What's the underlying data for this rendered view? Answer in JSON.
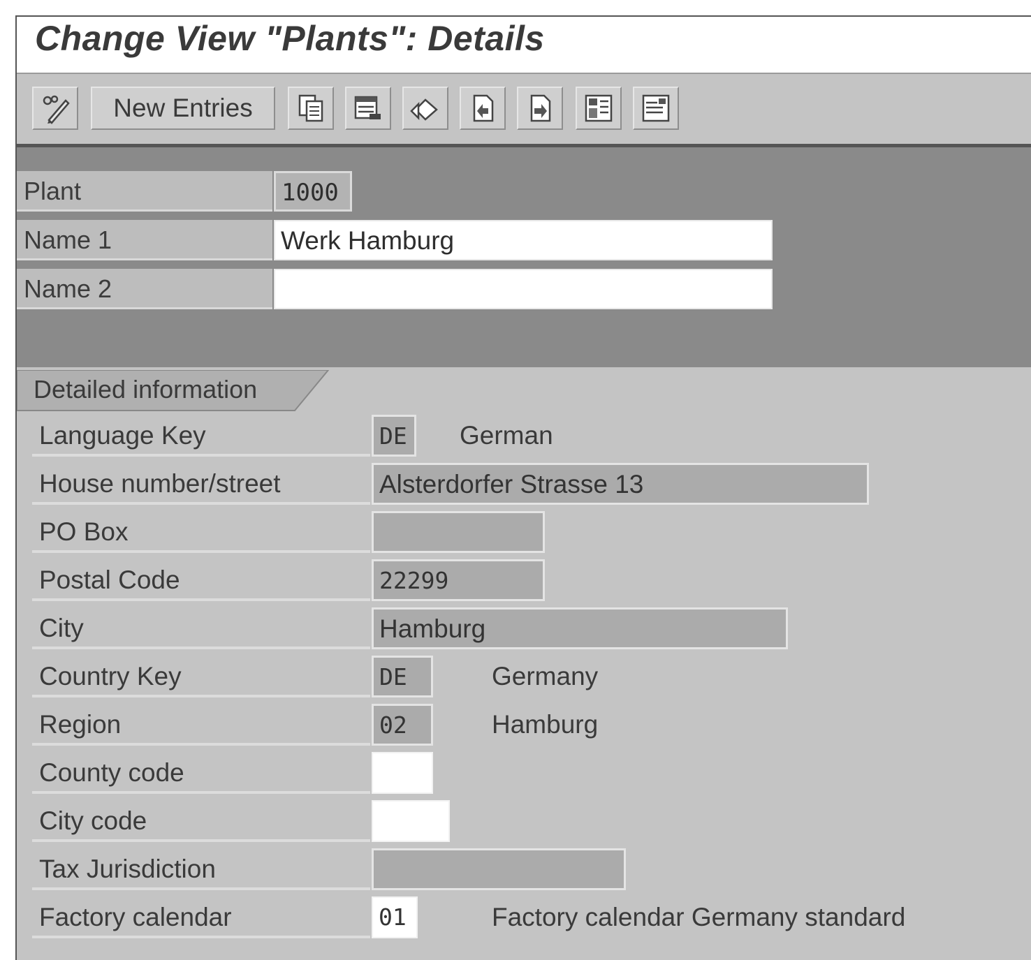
{
  "window": {
    "title": "Change View \"Plants\": Details"
  },
  "toolbar": {
    "new_entries_label": "New Entries",
    "icons": [
      "display-change-icon",
      "copy-icon",
      "delete-icon",
      "undo-icon",
      "previous-entry-icon",
      "next-entry-icon",
      "select-all-icon",
      "print-icon"
    ]
  },
  "header": {
    "plant": {
      "label": "Plant",
      "value": "1000"
    },
    "name1": {
      "label": "Name 1",
      "value": "Werk Hamburg"
    },
    "name2": {
      "label": "Name 2",
      "value": ""
    }
  },
  "detail": {
    "tab_label": "Detailed information",
    "language_key": {
      "label": "Language Key",
      "value": "DE",
      "description": "German"
    },
    "street": {
      "label": "House number/street",
      "value": "Alsterdorfer Strasse 13"
    },
    "po_box": {
      "label": "PO Box",
      "value": ""
    },
    "postal_code": {
      "label": "Postal Code",
      "value": "22299"
    },
    "city": {
      "label": "City",
      "value": "Hamburg"
    },
    "country_key": {
      "label": "Country Key",
      "value": "DE",
      "description": "Germany"
    },
    "region": {
      "label": "Region",
      "value": "02",
      "description": "Hamburg"
    },
    "county_code": {
      "label": "County code",
      "value": ""
    },
    "city_code": {
      "label": "City code",
      "value": ""
    },
    "tax_jurisdiction": {
      "label": "Tax Jurisdiction",
      "value": ""
    },
    "factory_calendar": {
      "label": "Factory calendar",
      "value": "01",
      "description": "Factory calendar Germany standard"
    }
  }
}
